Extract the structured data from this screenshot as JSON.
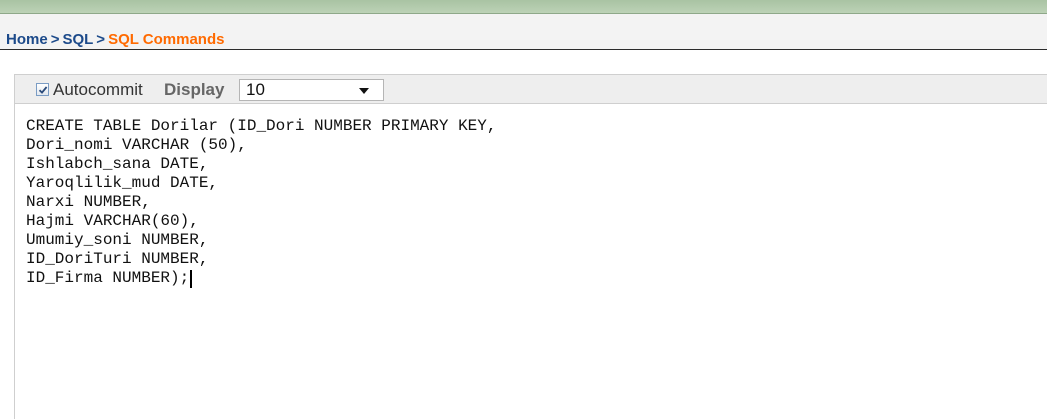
{
  "breadcrumb": {
    "home": "Home",
    "separator": ">",
    "sql": "SQL",
    "current": "SQL Commands"
  },
  "toolbar": {
    "autocommit_label": "Autocommit",
    "autocommit_checked": true,
    "display_label": "Display",
    "display_value": "10"
  },
  "editor": {
    "lines": [
      "CREATE TABLE Dorilar (ID_Dori NUMBER PRIMARY KEY,",
      "Dori_nomi VARCHAR (50),",
      "Ishlabch_sana DATE,",
      "Yaroqlilik_mud DATE,",
      "Narxi NUMBER,",
      "Hajmi VARCHAR(60),",
      "Umumiy_soni NUMBER,",
      "ID_DoriTuri NUMBER,",
      "ID_Firma NUMBER);"
    ]
  },
  "colors": {
    "link": "#1c4a8a",
    "current": "#ff6a00",
    "topbar": "#b4ccae"
  }
}
